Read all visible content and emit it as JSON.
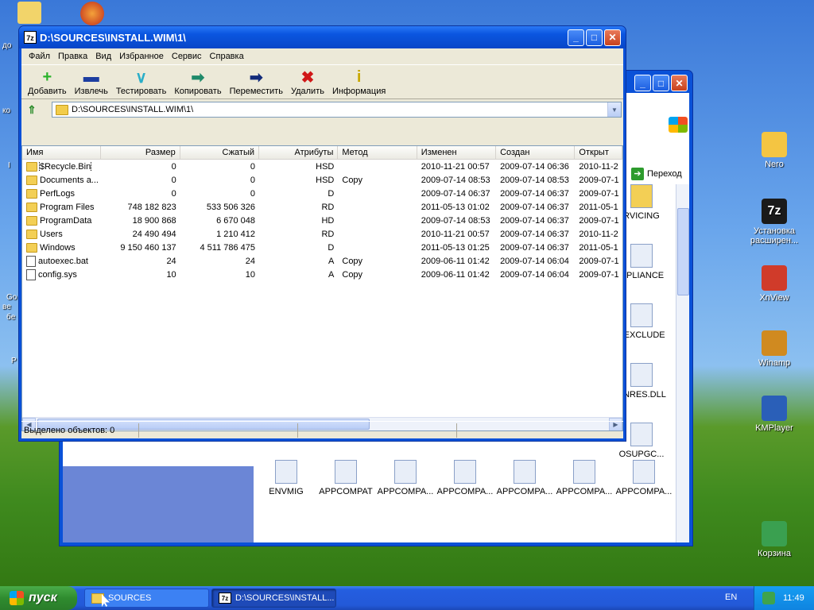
{
  "desktop": {
    "icons": [
      {
        "id": "nero",
        "label": "Nero",
        "color": "#f4c542"
      },
      {
        "id": "7zip",
        "label": "Установка расширен...",
        "color": "#1a1a1a"
      },
      {
        "id": "xnview",
        "label": "XnView",
        "color": "#d03b2a"
      },
      {
        "id": "winamp",
        "label": "Winamp",
        "color": "#d08a20"
      },
      {
        "id": "kmplayer",
        "label": "KMPlayer",
        "color": "#2a5fb8"
      },
      {
        "id": "recycle",
        "label": "Корзина",
        "color": "#3aa050"
      }
    ],
    "edge_texts": [
      "до",
      "ко",
      "I",
      "Go",
      "вe",
      "бe",
      "P"
    ]
  },
  "explorer_back": {
    "go_label": "Переход",
    "items_right": [
      "RVICING",
      "MPLIANCE",
      "VEXCLUDE",
      "UNRES.DLL",
      "OSUPGC..."
    ],
    "items_bottom": [
      "ENVMIG",
      "APPCOMPAT",
      "APPCOMPA...",
      "APPCOMPA...",
      "APPCOMPA...",
      "APPCOMPA...",
      "APPCOMPA..."
    ]
  },
  "window": {
    "title": "D:\\SOURCES\\INSTALL.WIM\\1\\",
    "app_icon": "7z",
    "menu": [
      "Файл",
      "Правка",
      "Вид",
      "Избранное",
      "Сервис",
      "Справка"
    ],
    "toolbar": [
      {
        "id": "add",
        "label": "Добавить",
        "icon": "plus-icon",
        "glyph": "+",
        "color": "#2ab32a"
      },
      {
        "id": "extract",
        "label": "Извлечь",
        "icon": "minus-icon",
        "glyph": "▬",
        "color": "#1c3da0"
      },
      {
        "id": "test",
        "label": "Тестировать",
        "icon": "check-icon",
        "glyph": "∨",
        "color": "#2aaec8"
      },
      {
        "id": "copy",
        "label": "Копировать",
        "icon": "copy-arrow-icon",
        "glyph": "➡",
        "color": "#1f8a6a"
      },
      {
        "id": "move",
        "label": "Переместить",
        "icon": "move-arrow-icon",
        "glyph": "➡",
        "color": "#122b7a"
      },
      {
        "id": "delete",
        "label": "Удалить",
        "icon": "delete-x-icon",
        "glyph": "✖",
        "color": "#d01818"
      },
      {
        "id": "info",
        "label": "Информация",
        "icon": "info-icon",
        "glyph": "i",
        "color": "#c8a800"
      }
    ],
    "address": "D:\\SOURCES\\INSTALL.WIM\\1\\",
    "columns": [
      "Имя",
      "Размер",
      "Сжатый",
      "Атрибуты",
      "Метод",
      "Изменен",
      "Создан",
      "Открыт"
    ],
    "rows": [
      {
        "type": "folder",
        "name": "$Recycle.Bin",
        "size": "0",
        "packed": "0",
        "attr": "HSD",
        "method": "",
        "modified": "2010-11-21 00:57",
        "created": "2009-07-14 06:36",
        "accessed": "2010-11-2"
      },
      {
        "type": "folder",
        "name": "Documents a...",
        "size": "0",
        "packed": "0",
        "attr": "HSD",
        "method": "Copy",
        "modified": "2009-07-14 08:53",
        "created": "2009-07-14 08:53",
        "accessed": "2009-07-1"
      },
      {
        "type": "folder",
        "name": "PerfLogs",
        "size": "0",
        "packed": "0",
        "attr": "D",
        "method": "",
        "modified": "2009-07-14 06:37",
        "created": "2009-07-14 06:37",
        "accessed": "2009-07-1"
      },
      {
        "type": "folder",
        "name": "Program Files",
        "size": "748 182 823",
        "packed": "533 506 326",
        "attr": "RD",
        "method": "",
        "modified": "2011-05-13 01:02",
        "created": "2009-07-14 06:37",
        "accessed": "2011-05-1"
      },
      {
        "type": "folder",
        "name": "ProgramData",
        "size": "18 900 868",
        "packed": "6 670 048",
        "attr": "HD",
        "method": "",
        "modified": "2009-07-14 08:53",
        "created": "2009-07-14 06:37",
        "accessed": "2009-07-1"
      },
      {
        "type": "folder",
        "name": "Users",
        "size": "24 490 494",
        "packed": "1 210 412",
        "attr": "RD",
        "method": "",
        "modified": "2010-11-21 00:57",
        "created": "2009-07-14 06:37",
        "accessed": "2010-11-2"
      },
      {
        "type": "folder",
        "name": "Windows",
        "size": "9 150 460 137",
        "packed": "4 511 786 475",
        "attr": "D",
        "method": "",
        "modified": "2011-05-13 01:25",
        "created": "2009-07-14 06:37",
        "accessed": "2011-05-1"
      },
      {
        "type": "file",
        "name": "autoexec.bat",
        "size": "24",
        "packed": "24",
        "attr": "A",
        "method": "Copy",
        "modified": "2009-06-11 01:42",
        "created": "2009-07-14 06:04",
        "accessed": "2009-07-1"
      },
      {
        "type": "file",
        "name": "config.sys",
        "size": "10",
        "packed": "10",
        "attr": "A",
        "method": "Copy",
        "modified": "2009-06-11 01:42",
        "created": "2009-07-14 06:04",
        "accessed": "2009-07-1"
      }
    ],
    "status": [
      "Выделено объектов: 0",
      "",
      "",
      ""
    ]
  },
  "taskbar": {
    "start_label": "пуск",
    "tasks": [
      {
        "label": "SOURCES",
        "icon": "folder-icon"
      },
      {
        "label": "D:\\SOURCES\\INSTALL...",
        "icon": "7zip-icon"
      }
    ],
    "lang": "EN",
    "clock": "11:49"
  }
}
